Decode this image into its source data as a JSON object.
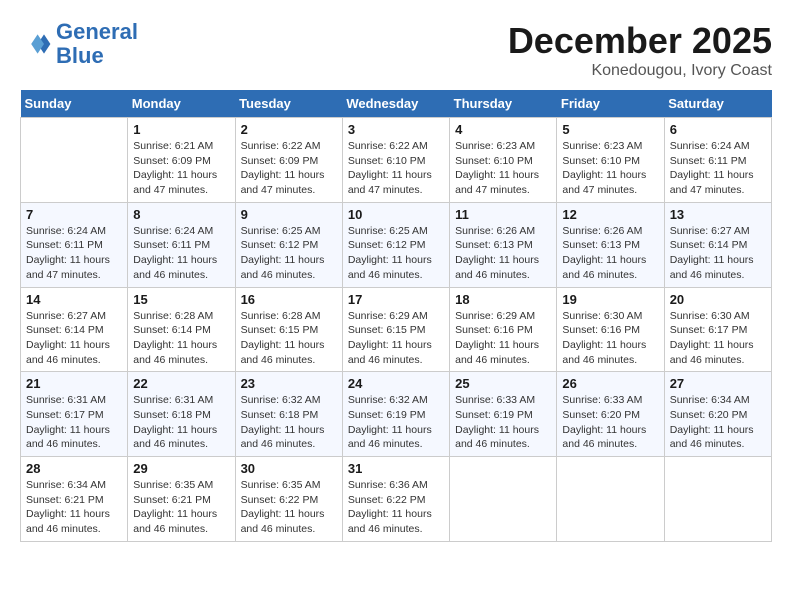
{
  "logo": {
    "line1": "General",
    "line2": "Blue"
  },
  "title": "December 2025",
  "subtitle": "Konedougou, Ivory Coast",
  "days_header": [
    "Sunday",
    "Monday",
    "Tuesday",
    "Wednesday",
    "Thursday",
    "Friday",
    "Saturday"
  ],
  "weeks": [
    [
      {
        "day": "",
        "info": ""
      },
      {
        "day": "1",
        "info": "Sunrise: 6:21 AM\nSunset: 6:09 PM\nDaylight: 11 hours\nand 47 minutes."
      },
      {
        "day": "2",
        "info": "Sunrise: 6:22 AM\nSunset: 6:09 PM\nDaylight: 11 hours\nand 47 minutes."
      },
      {
        "day": "3",
        "info": "Sunrise: 6:22 AM\nSunset: 6:10 PM\nDaylight: 11 hours\nand 47 minutes."
      },
      {
        "day": "4",
        "info": "Sunrise: 6:23 AM\nSunset: 6:10 PM\nDaylight: 11 hours\nand 47 minutes."
      },
      {
        "day": "5",
        "info": "Sunrise: 6:23 AM\nSunset: 6:10 PM\nDaylight: 11 hours\nand 47 minutes."
      },
      {
        "day": "6",
        "info": "Sunrise: 6:24 AM\nSunset: 6:11 PM\nDaylight: 11 hours\nand 47 minutes."
      }
    ],
    [
      {
        "day": "7",
        "info": "Sunrise: 6:24 AM\nSunset: 6:11 PM\nDaylight: 11 hours\nand 47 minutes."
      },
      {
        "day": "8",
        "info": "Sunrise: 6:24 AM\nSunset: 6:11 PM\nDaylight: 11 hours\nand 46 minutes."
      },
      {
        "day": "9",
        "info": "Sunrise: 6:25 AM\nSunset: 6:12 PM\nDaylight: 11 hours\nand 46 minutes."
      },
      {
        "day": "10",
        "info": "Sunrise: 6:25 AM\nSunset: 6:12 PM\nDaylight: 11 hours\nand 46 minutes."
      },
      {
        "day": "11",
        "info": "Sunrise: 6:26 AM\nSunset: 6:13 PM\nDaylight: 11 hours\nand 46 minutes."
      },
      {
        "day": "12",
        "info": "Sunrise: 6:26 AM\nSunset: 6:13 PM\nDaylight: 11 hours\nand 46 minutes."
      },
      {
        "day": "13",
        "info": "Sunrise: 6:27 AM\nSunset: 6:14 PM\nDaylight: 11 hours\nand 46 minutes."
      }
    ],
    [
      {
        "day": "14",
        "info": "Sunrise: 6:27 AM\nSunset: 6:14 PM\nDaylight: 11 hours\nand 46 minutes."
      },
      {
        "day": "15",
        "info": "Sunrise: 6:28 AM\nSunset: 6:14 PM\nDaylight: 11 hours\nand 46 minutes."
      },
      {
        "day": "16",
        "info": "Sunrise: 6:28 AM\nSunset: 6:15 PM\nDaylight: 11 hours\nand 46 minutes."
      },
      {
        "day": "17",
        "info": "Sunrise: 6:29 AM\nSunset: 6:15 PM\nDaylight: 11 hours\nand 46 minutes."
      },
      {
        "day": "18",
        "info": "Sunrise: 6:29 AM\nSunset: 6:16 PM\nDaylight: 11 hours\nand 46 minutes."
      },
      {
        "day": "19",
        "info": "Sunrise: 6:30 AM\nSunset: 6:16 PM\nDaylight: 11 hours\nand 46 minutes."
      },
      {
        "day": "20",
        "info": "Sunrise: 6:30 AM\nSunset: 6:17 PM\nDaylight: 11 hours\nand 46 minutes."
      }
    ],
    [
      {
        "day": "21",
        "info": "Sunrise: 6:31 AM\nSunset: 6:17 PM\nDaylight: 11 hours\nand 46 minutes."
      },
      {
        "day": "22",
        "info": "Sunrise: 6:31 AM\nSunset: 6:18 PM\nDaylight: 11 hours\nand 46 minutes."
      },
      {
        "day": "23",
        "info": "Sunrise: 6:32 AM\nSunset: 6:18 PM\nDaylight: 11 hours\nand 46 minutes."
      },
      {
        "day": "24",
        "info": "Sunrise: 6:32 AM\nSunset: 6:19 PM\nDaylight: 11 hours\nand 46 minutes."
      },
      {
        "day": "25",
        "info": "Sunrise: 6:33 AM\nSunset: 6:19 PM\nDaylight: 11 hours\nand 46 minutes."
      },
      {
        "day": "26",
        "info": "Sunrise: 6:33 AM\nSunset: 6:20 PM\nDaylight: 11 hours\nand 46 minutes."
      },
      {
        "day": "27",
        "info": "Sunrise: 6:34 AM\nSunset: 6:20 PM\nDaylight: 11 hours\nand 46 minutes."
      }
    ],
    [
      {
        "day": "28",
        "info": "Sunrise: 6:34 AM\nSunset: 6:21 PM\nDaylight: 11 hours\nand 46 minutes."
      },
      {
        "day": "29",
        "info": "Sunrise: 6:35 AM\nSunset: 6:21 PM\nDaylight: 11 hours\nand 46 minutes."
      },
      {
        "day": "30",
        "info": "Sunrise: 6:35 AM\nSunset: 6:22 PM\nDaylight: 11 hours\nand 46 minutes."
      },
      {
        "day": "31",
        "info": "Sunrise: 6:36 AM\nSunset: 6:22 PM\nDaylight: 11 hours\nand 46 minutes."
      },
      {
        "day": "",
        "info": ""
      },
      {
        "day": "",
        "info": ""
      },
      {
        "day": "",
        "info": ""
      }
    ]
  ]
}
